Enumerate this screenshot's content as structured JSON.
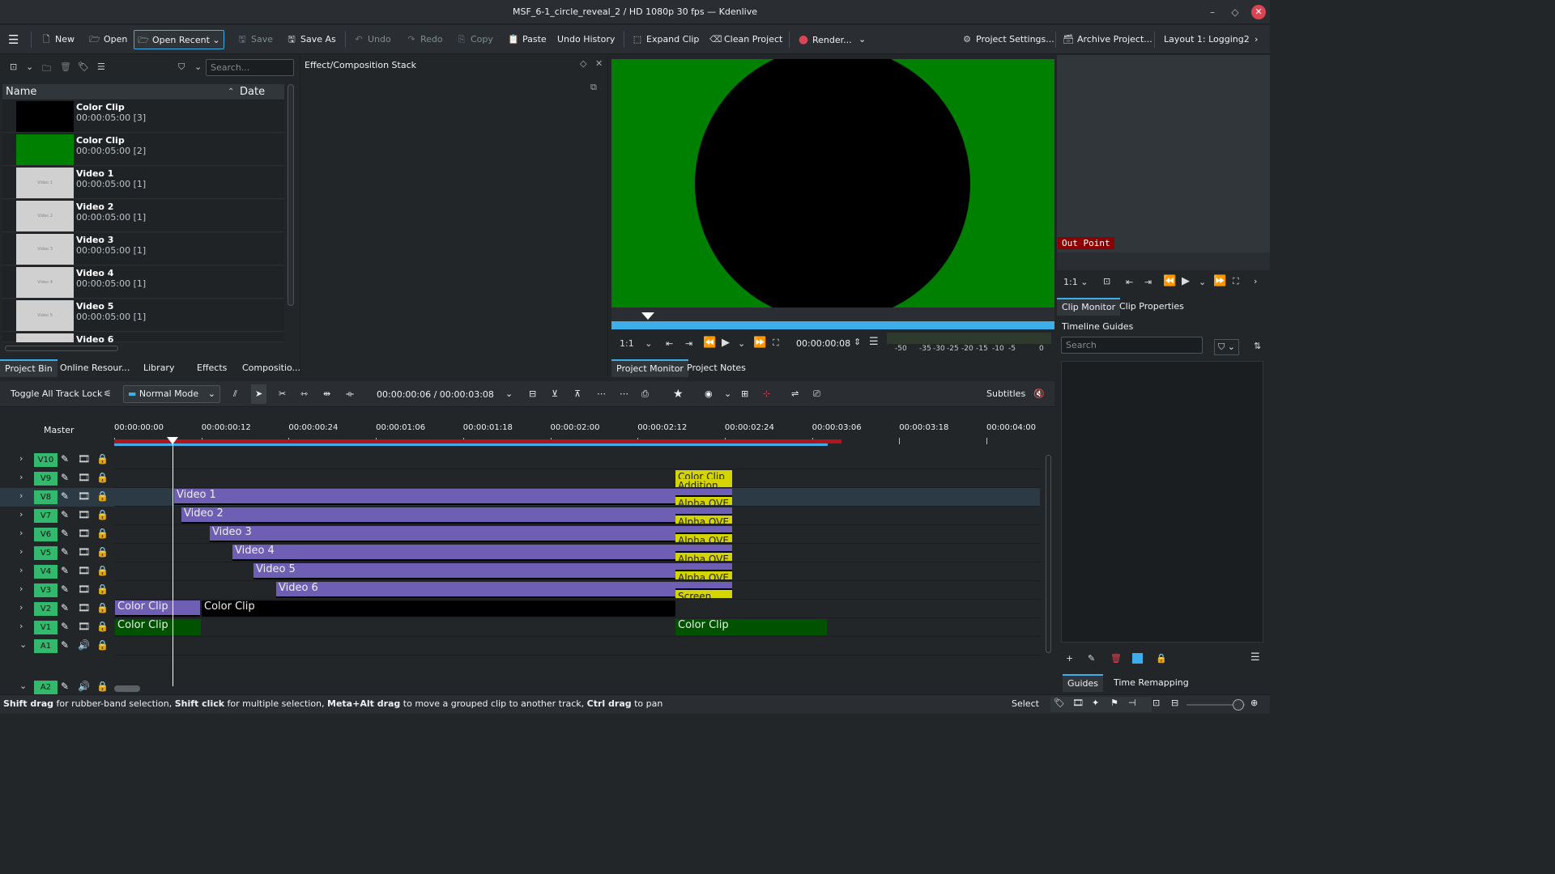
{
  "window": {
    "title": "MSF_6-1_circle_reveal_2 / HD 1080p 30 fps — Kdenlive"
  },
  "toolbar": {
    "new": "New",
    "open": "Open",
    "open_recent": "Open Recent",
    "save": "Save",
    "save_as": "Save As",
    "undo": "Undo",
    "redo": "Redo",
    "copy": "Copy",
    "paste": "Paste",
    "undo_history": "Undo History",
    "expand_clip": "Expand Clip",
    "clean_project": "Clean Project",
    "render": "Render...",
    "project_settings": "Project Settings...",
    "archive_project": "Archive Project...",
    "layout": "Layout 1: Logging2"
  },
  "bin": {
    "search_placeholder": "Search...",
    "col_name": "Name",
    "col_date": "Date",
    "items": [
      {
        "name": "Color Clip",
        "dur": "00:00:05:00 [3]",
        "thumb": "#000000",
        "label": ""
      },
      {
        "name": "Color Clip",
        "dur": "00:00:05:00 [2]",
        "thumb": "#008000",
        "label": ""
      },
      {
        "name": "Video 1",
        "dur": "00:00:05:00 [1]",
        "thumb": "#d0d0d0",
        "label": "Video 1"
      },
      {
        "name": "Video 2",
        "dur": "00:00:05:00 [1]",
        "thumb": "#d0d0d0",
        "label": "Video 2"
      },
      {
        "name": "Video 3",
        "dur": "00:00:05:00 [1]",
        "thumb": "#d0d0d0",
        "label": "Video 3"
      },
      {
        "name": "Video 4",
        "dur": "00:00:05:00 [1]",
        "thumb": "#d0d0d0",
        "label": "Video 4"
      },
      {
        "name": "Video 5",
        "dur": "00:00:05:00 [1]",
        "thumb": "#d0d0d0",
        "label": "Video 5"
      },
      {
        "name": "Video 6",
        "dur": "",
        "thumb": "#d0d0d0",
        "label": ""
      }
    ],
    "tabs": [
      "Project Bin",
      "Online Resour...",
      "Library",
      "Effects",
      "Compositio..."
    ]
  },
  "effect_stack": {
    "title": "Effect/Composition Stack"
  },
  "monitor": {
    "zoom": "1:1",
    "timecode": "00:00:00:08",
    "vu_labels": [
      "-50",
      "-35",
      "-30",
      "-25",
      "-20",
      "-15",
      "-10",
      "-5",
      "0"
    ],
    "tabs": [
      "Project Monitor",
      "Project Notes"
    ]
  },
  "clip_monitor": {
    "out_point": "Out Point",
    "zoom": "1:1",
    "tabs": [
      "Clip Monitor",
      "Clip Properties"
    ]
  },
  "guides": {
    "title": "Timeline Guides",
    "search_placeholder": "Search",
    "tabs": [
      "Guides",
      "Time Remapping"
    ]
  },
  "timeline": {
    "toggle_lock": "Toggle All Track Lock",
    "mode": "Normal Mode",
    "timecode": "00:00:00:06 / 00:00:03:08",
    "subtitles": "Subtitles",
    "master": "Master",
    "ruler": [
      "00:00:00:00",
      "00:00:00:12",
      "00:00:00:24",
      "00:00:01:06",
      "00:00:01:18",
      "00:00:02:00",
      "00:00:02:12",
      "00:00:02:24",
      "00:00:03:06",
      "00:00:03:18",
      "00:00:04:00"
    ],
    "tracks": [
      "V10",
      "V9",
      "V8",
      "V7",
      "V6",
      "V5",
      "V4",
      "V3",
      "V2",
      "V1",
      "A1",
      "A2"
    ],
    "clips": {
      "v9_color": "Color Clip",
      "v9_comp": "Addition",
      "v8": "Video 1",
      "v7": "Video 2",
      "v6": "Video 3",
      "v5": "Video 4",
      "v4": "Video 5",
      "v3": "Video 6",
      "comp_alpha": "Alpha OVE",
      "comp_screen": "Screen",
      "v2a": "Color Clip",
      "v2b": "Color Clip",
      "v1a": "Color Clip",
      "v1b": "Color Clip"
    }
  },
  "status": {
    "k1": "Shift drag",
    "t1": " for rubber-band selection, ",
    "k2": "Shift click",
    "t2": " for multiple selection, ",
    "k3": "Meta+Alt drag",
    "t3": " to move a grouped clip to another track, ",
    "k4": "Ctrl drag",
    "t4": " to pan",
    "select": "Select"
  }
}
